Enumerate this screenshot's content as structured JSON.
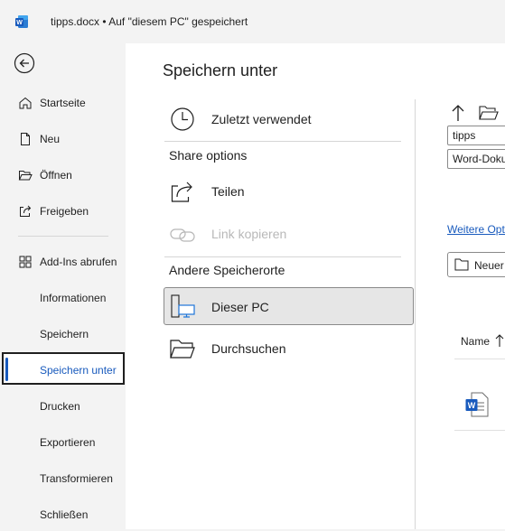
{
  "titlebar": {
    "logo_icon": "word-logo-icon",
    "title": "tipps.docx • Auf \"diesem PC\" gespeichert"
  },
  "sidebar": {
    "back_icon": "back-arrow-icon",
    "items": [
      {
        "label": "Startseite",
        "icon": "home-icon"
      },
      {
        "label": "Neu",
        "icon": "new-document-icon"
      },
      {
        "label": "Öffnen",
        "icon": "folder-open-icon"
      },
      {
        "label": "Freigeben",
        "icon": "share-icon"
      },
      {
        "label": "Add-Ins abrufen",
        "icon": "addins-grid-icon"
      },
      {
        "label": "Informationen"
      },
      {
        "label": "Speichern"
      },
      {
        "label": "Speichern unter",
        "selected": true
      },
      {
        "label": "Drucken"
      },
      {
        "label": "Exportieren"
      },
      {
        "label": "Transformieren"
      },
      {
        "label": "Schließen"
      }
    ]
  },
  "main": {
    "title": "Speichern unter",
    "recent": {
      "label": "Zuletzt verwendet",
      "icon": "clock-icon"
    },
    "share_header": "Share options",
    "share_items": [
      {
        "label": "Teilen",
        "icon": "share-arrow-icon"
      },
      {
        "label": "Link kopieren",
        "icon": "link-icon",
        "disabled": true
      }
    ],
    "other_header": "Andere Speicherorte",
    "other_items": [
      {
        "label": "Dieser PC",
        "icon": "this-pc-icon",
        "selected": true
      },
      {
        "label": "Durchsuchen",
        "icon": "folder-browse-icon"
      }
    ]
  },
  "right_pane": {
    "filename_value": "tipps",
    "filetype_value": "Word-Dokument (*.docx)",
    "more_options_link": "Weitere Optionen...",
    "new_folder_label": "Neuer Ordner",
    "name_column": "Name",
    "up_icon": "up-arrow-icon",
    "folder_icon": "browse-folder-icon",
    "sort_icon": "sort-ascending-icon",
    "file_icon": "word-document-icon"
  },
  "colors": {
    "accent": "#185abd",
    "sidebar_bg": "#f3f3f3",
    "main_bg": "#ffffff",
    "selected_bg": "#e6e6e6"
  }
}
